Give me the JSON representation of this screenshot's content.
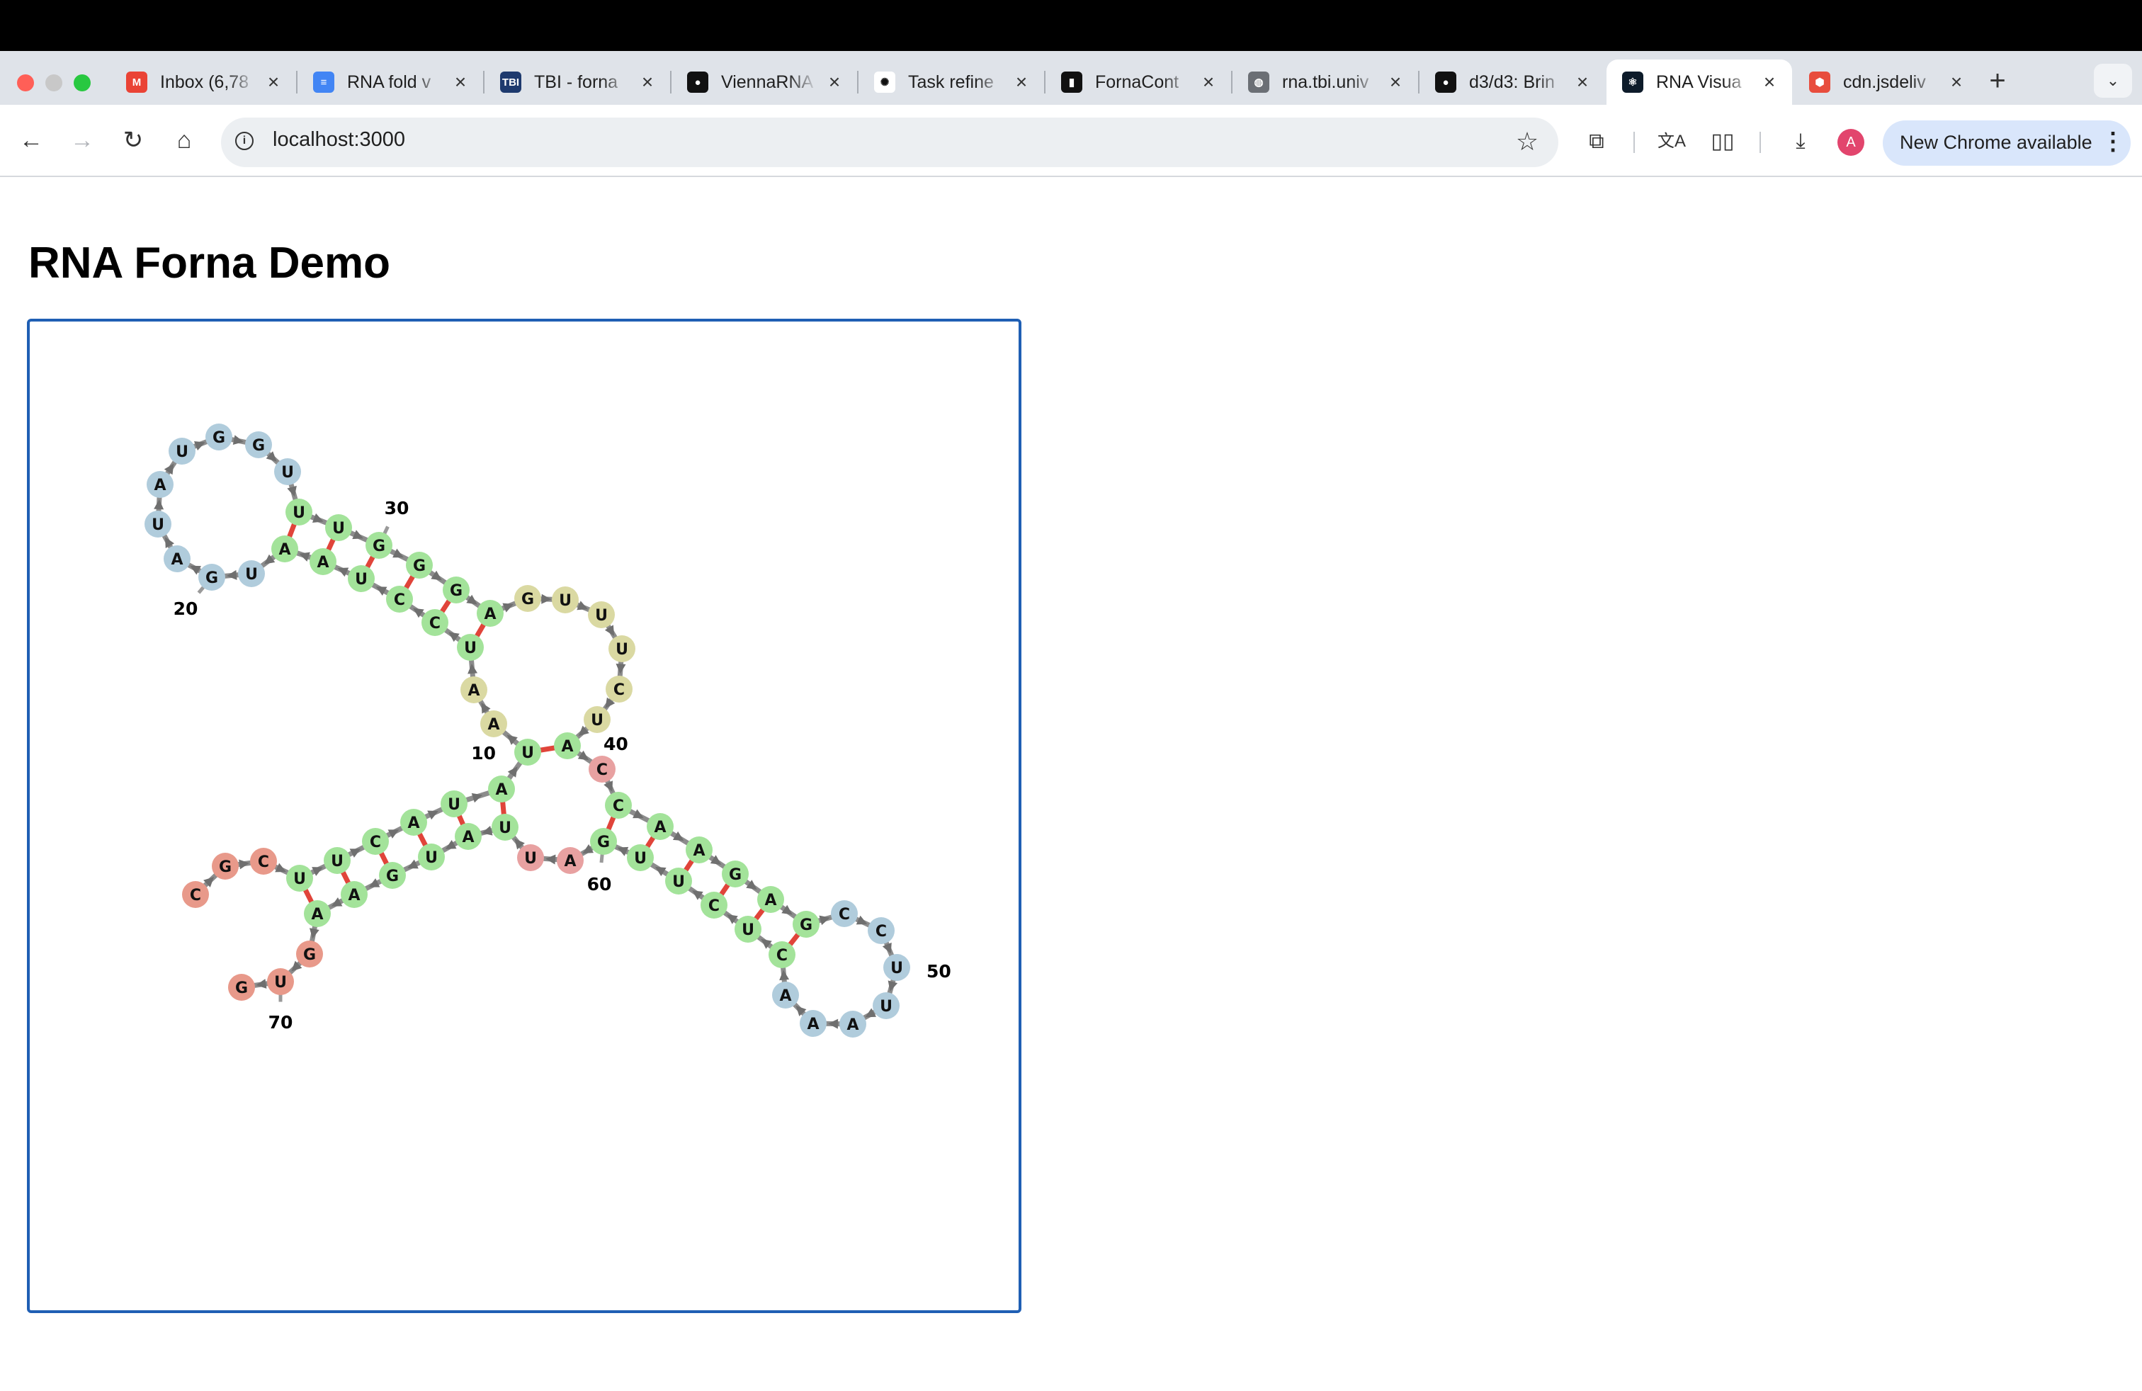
{
  "browser": {
    "tabs": [
      {
        "title": "Inbox (6,78",
        "favicon": "gmail-icon",
        "color": "#ea4335",
        "glyph": "M"
      },
      {
        "title": "RNA fold v",
        "favicon": "google-docs-icon",
        "color": "#4285f4",
        "glyph": "≡"
      },
      {
        "title": "TBI - forna",
        "favicon": "tbi-icon",
        "color": "#1e3a6e",
        "glyph": "TBI"
      },
      {
        "title": "ViennaRNA",
        "favicon": "github-icon",
        "color": "#111111",
        "glyph": "●"
      },
      {
        "title": "Task refine",
        "favicon": "openai-icon",
        "color": "#ffffff",
        "glyph": "✺"
      },
      {
        "title": "FornaCont",
        "favicon": "fornacontainer-icon",
        "color": "#111111",
        "glyph": "▮"
      },
      {
        "title": "rna.tbi.univ",
        "favicon": "globe-icon",
        "color": "#6b6f75",
        "glyph": "◍"
      },
      {
        "title": "d3/d3: Brin",
        "favicon": "github-icon",
        "color": "#111111",
        "glyph": "●"
      },
      {
        "title": "RNA Visua",
        "favicon": "react-icon",
        "color": "#0d1b2a",
        "glyph": "⚛",
        "active": true
      },
      {
        "title": "cdn.jsdeliv",
        "favicon": "jsdelivr-icon",
        "color": "#e84d3d",
        "glyph": "⬢"
      }
    ],
    "url": "localhost:3000",
    "avatar_letter": "A",
    "update_label": "New Chrome available"
  },
  "page": {
    "title": "RNA Forna Demo"
  },
  "rna": {
    "nodes": [
      {
        "n": 1,
        "b": "C",
        "c": "#e8998a"
      },
      {
        "n": 2,
        "b": "G",
        "c": "#e8998a"
      },
      {
        "n": 3,
        "b": "C",
        "c": "#e8998a"
      },
      {
        "n": 4,
        "b": "U",
        "c": "#a3e39a"
      },
      {
        "n": 5,
        "b": "U",
        "c": "#a3e39a"
      },
      {
        "n": 6,
        "b": "C",
        "c": "#a3e39a"
      },
      {
        "n": 7,
        "b": "A",
        "c": "#a3e39a"
      },
      {
        "n": 8,
        "b": "U",
        "c": "#a3e39a"
      },
      {
        "n": 9,
        "b": "A",
        "c": "#a3e39a"
      },
      {
        "n": 10,
        "b": "U",
        "c": "#a3e39a"
      },
      {
        "n": 11,
        "b": "A",
        "c": "#dad9a2"
      },
      {
        "n": 12,
        "b": "A",
        "c": "#dad9a2"
      },
      {
        "n": 13,
        "b": "U",
        "c": "#a3e39a"
      },
      {
        "n": 14,
        "b": "C",
        "c": "#a3e39a"
      },
      {
        "n": 15,
        "b": "C",
        "c": "#a3e39a"
      },
      {
        "n": 16,
        "b": "U",
        "c": "#a3e39a"
      },
      {
        "n": 17,
        "b": "A",
        "c": "#a3e39a"
      },
      {
        "n": 18,
        "b": "A",
        "c": "#a3e39a"
      },
      {
        "n": 19,
        "b": "U",
        "c": "#b0ccdc"
      },
      {
        "n": 20,
        "b": "G",
        "c": "#b0ccdc"
      },
      {
        "n": 21,
        "b": "A",
        "c": "#b0ccdc"
      },
      {
        "n": 22,
        "b": "U",
        "c": "#b0ccdc"
      },
      {
        "n": 23,
        "b": "A",
        "c": "#b0ccdc"
      },
      {
        "n": 24,
        "b": "U",
        "c": "#b0ccdc"
      },
      {
        "n": 25,
        "b": "G",
        "c": "#b0ccdc"
      },
      {
        "n": 26,
        "b": "G",
        "c": "#b0ccdc"
      },
      {
        "n": 27,
        "b": "U",
        "c": "#b0ccdc"
      },
      {
        "n": 28,
        "b": "U",
        "c": "#a3e39a"
      },
      {
        "n": 29,
        "b": "U",
        "c": "#a3e39a"
      },
      {
        "n": 30,
        "b": "G",
        "c": "#a3e39a"
      },
      {
        "n": 31,
        "b": "G",
        "c": "#a3e39a"
      },
      {
        "n": 32,
        "b": "G",
        "c": "#a3e39a"
      },
      {
        "n": 33,
        "b": "A",
        "c": "#a3e39a"
      },
      {
        "n": 34,
        "b": "G",
        "c": "#dad9a2"
      },
      {
        "n": 35,
        "b": "U",
        "c": "#dad9a2"
      },
      {
        "n": 36,
        "b": "U",
        "c": "#dad9a2"
      },
      {
        "n": 37,
        "b": "U",
        "c": "#dad9a2"
      },
      {
        "n": 38,
        "b": "C",
        "c": "#dad9a2"
      },
      {
        "n": 39,
        "b": "U",
        "c": "#dad9a2"
      },
      {
        "n": 40,
        "b": "A",
        "c": "#a3e39a"
      },
      {
        "n": 41,
        "b": "C",
        "c": "#e8a1a1"
      },
      {
        "n": 42,
        "b": "C",
        "c": "#a3e39a"
      },
      {
        "n": 43,
        "b": "A",
        "c": "#a3e39a"
      },
      {
        "n": 44,
        "b": "A",
        "c": "#a3e39a"
      },
      {
        "n": 45,
        "b": "G",
        "c": "#a3e39a"
      },
      {
        "n": 46,
        "b": "A",
        "c": "#a3e39a"
      },
      {
        "n": 47,
        "b": "G",
        "c": "#a3e39a"
      },
      {
        "n": 48,
        "b": "C",
        "c": "#b0ccdc"
      },
      {
        "n": 49,
        "b": "C",
        "c": "#b0ccdc"
      },
      {
        "n": 50,
        "b": "U",
        "c": "#b0ccdc"
      },
      {
        "n": 51,
        "b": "U",
        "c": "#b0ccdc"
      },
      {
        "n": 52,
        "b": "A",
        "c": "#b0ccdc"
      },
      {
        "n": 53,
        "b": "A",
        "c": "#b0ccdc"
      },
      {
        "n": 54,
        "b": "A",
        "c": "#b0ccdc"
      },
      {
        "n": 55,
        "b": "C",
        "c": "#a3e39a"
      },
      {
        "n": 56,
        "b": "U",
        "c": "#a3e39a"
      },
      {
        "n": 57,
        "b": "C",
        "c": "#a3e39a"
      },
      {
        "n": 58,
        "b": "U",
        "c": "#a3e39a"
      },
      {
        "n": 59,
        "b": "U",
        "c": "#a3e39a"
      },
      {
        "n": 60,
        "b": "G",
        "c": "#a3e39a"
      },
      {
        "n": 61,
        "b": "A",
        "c": "#e8a1a1"
      },
      {
        "n": 62,
        "b": "U",
        "c": "#e8a1a1"
      },
      {
        "n": 63,
        "b": "U",
        "c": "#a3e39a"
      },
      {
        "n": 64,
        "b": "A",
        "c": "#a3e39a"
      },
      {
        "n": 65,
        "b": "U",
        "c": "#a3e39a"
      },
      {
        "n": 66,
        "b": "G",
        "c": "#a3e39a"
      },
      {
        "n": 67,
        "b": "A",
        "c": "#a3e39a"
      },
      {
        "n": 68,
        "b": "A",
        "c": "#a3e39a"
      },
      {
        "n": 69,
        "b": "G",
        "c": "#e8998a"
      },
      {
        "n": 70,
        "b": "U",
        "c": "#e8998a"
      },
      {
        "n": 71,
        "b": "G",
        "c": "#e8998a"
      }
    ],
    "pairs": [
      [
        4,
        68
      ],
      [
        5,
        67
      ],
      [
        6,
        66
      ],
      [
        7,
        65
      ],
      [
        8,
        64
      ],
      [
        9,
        63
      ],
      [
        10,
        40
      ],
      [
        13,
        33
      ],
      [
        14,
        32
      ],
      [
        15,
        31
      ],
      [
        16,
        30
      ],
      [
        17,
        29
      ],
      [
        18,
        28
      ],
      [
        42,
        60
      ],
      [
        43,
        59
      ],
      [
        44,
        58
      ],
      [
        45,
        57
      ],
      [
        46,
        56
      ],
      [
        47,
        55
      ]
    ],
    "labels": [
      "10",
      "20",
      "30",
      "40",
      "50",
      "60",
      "70"
    ],
    "pair_color": "#e0443a",
    "backbone_color": "#8c8c8c"
  }
}
